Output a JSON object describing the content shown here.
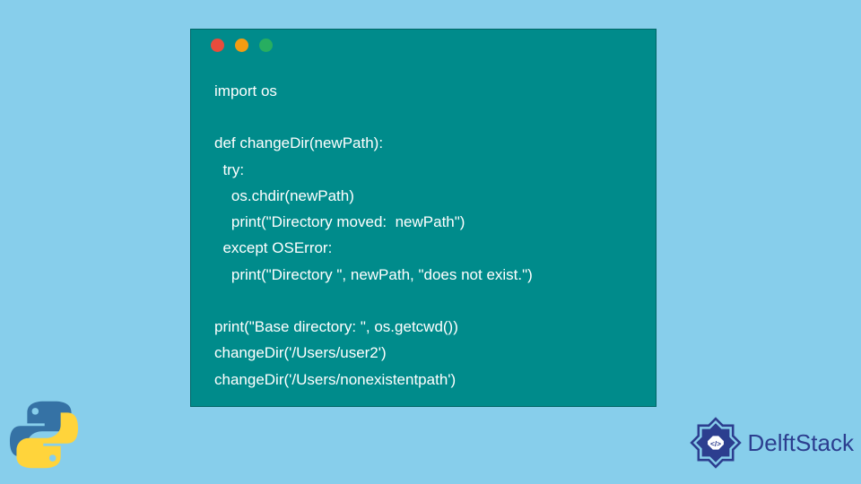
{
  "codeLines": {
    "l1": "import os",
    "l2": "",
    "l3": "def changeDir(newPath):",
    "l4": "  try:",
    "l5": "    os.chdir(newPath)",
    "l6": "    print(\"Directory moved:  newPath\")",
    "l7": "  except OSError:",
    "l8": "    print(\"Directory \", newPath, \"does not exist.\")",
    "l9": "",
    "l10": "print(\"Base directory: \", os.getcwd())",
    "l11": "changeDir('/Users/user2')",
    "l12": "changeDir('/Users/nonexistentpath')"
  },
  "branding": {
    "delftStack": "DelftStack"
  }
}
